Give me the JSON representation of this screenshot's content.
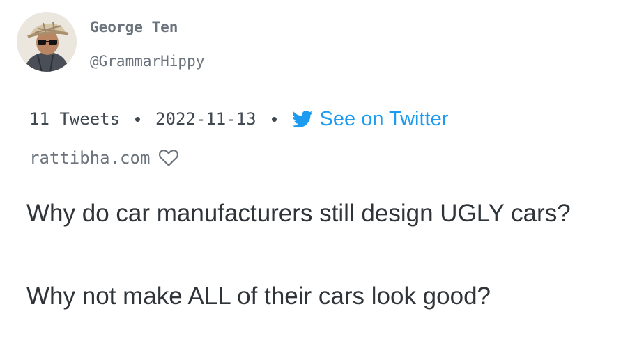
{
  "author": {
    "name": "George Ten",
    "handle": "@GrammarHippy",
    "avatar_icon": "profile-photo-avatar"
  },
  "thread_meta": {
    "tweet_count": "11 Tweets",
    "date": "2022-11-13",
    "twitter_link_label": "See on Twitter",
    "twitter_icon": "twitter-bird-icon"
  },
  "source": {
    "site": "rattibha.com",
    "favorite_icon": "heart-icon"
  },
  "tweet": {
    "lines": [
      "Why do car manufacturers still design UGLY cars?",
      "Why not make ALL of their cars look good?"
    ]
  },
  "colors": {
    "twitter_blue": "#1d9bf0",
    "muted_text": "#6b737d",
    "body_text": "#2f3439"
  }
}
